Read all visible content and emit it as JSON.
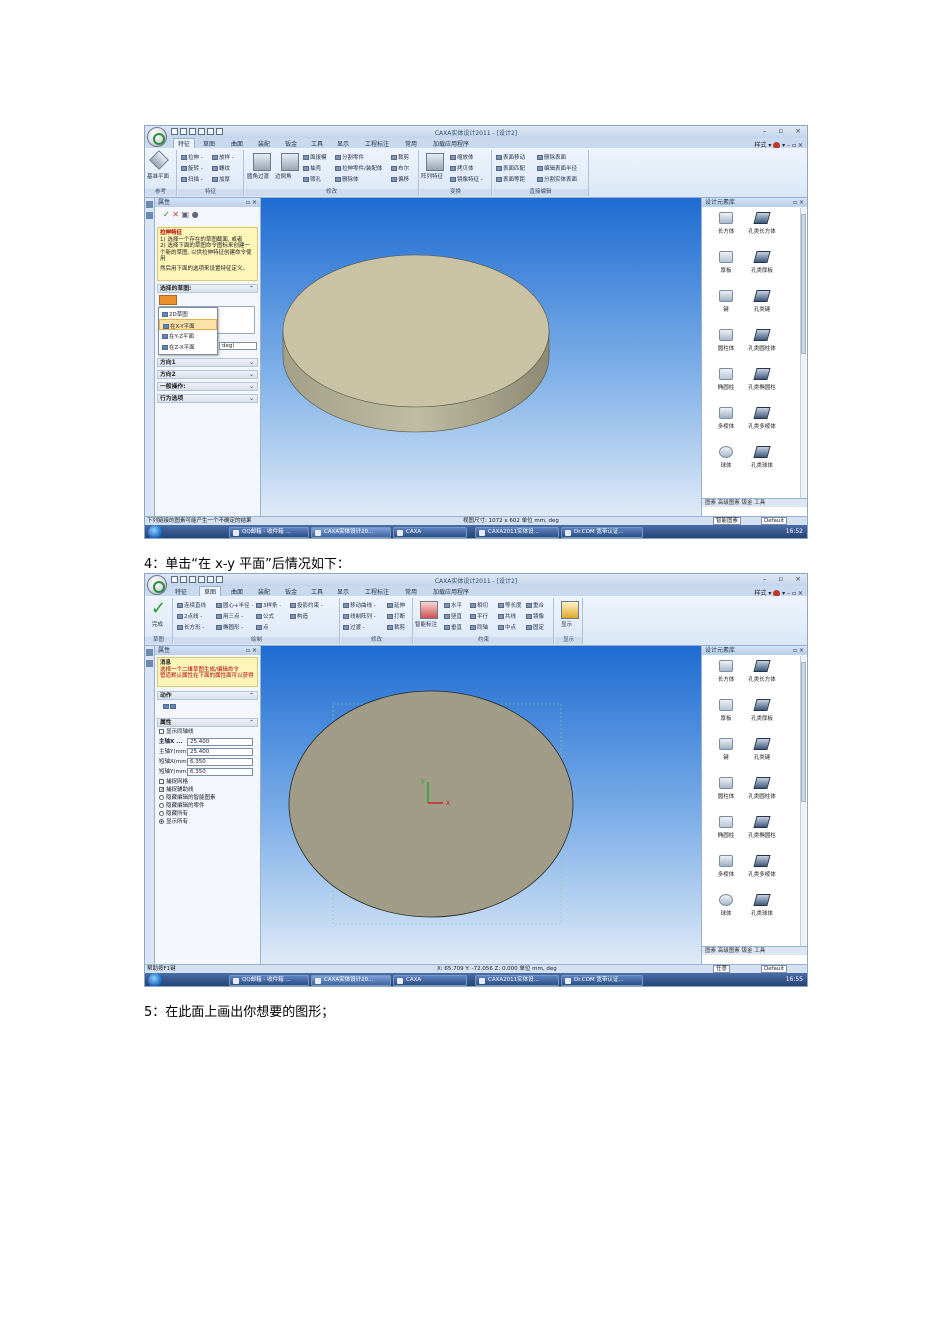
{
  "captions": {
    "step4": "4：单击“在 x-y 平面”后情况如下：",
    "step5": "5：在此面上画出你想要的图形；"
  },
  "app": {
    "window_title": "CAXA实体设计2011 - [设计2]",
    "style_label": "样式",
    "window_controls": [
      "–",
      "▫",
      "×"
    ]
  },
  "shot1": {
    "tabs": [
      "特征",
      "草图",
      "曲面",
      "装配",
      "钣金",
      "工具",
      "显示",
      "工程标注",
      "常用",
      "加载应用程序"
    ],
    "active_tab": "特征",
    "ribbon_groups": [
      {
        "label": "参考",
        "items": [
          "基准平面"
        ]
      },
      {
        "label": "特征",
        "items": [
          "拉伸 -",
          "旋转 -",
          "扫描 -",
          "放样 -",
          "螺纹",
          "加厚"
        ]
      },
      {
        "label": "修改",
        "items": [
          "圆角过渡",
          "边倒角",
          "面拔模",
          "抽壳",
          "筛孔",
          "分割零件",
          "拉伸零件/装配体",
          "删除体",
          "裁剪",
          "布尔",
          "偏移"
        ]
      },
      {
        "label": "变换",
        "items": [
          "阵列特征",
          "镜像特征 -",
          "缩放体",
          "拷贝体"
        ]
      },
      {
        "label": "直接编辑",
        "items": [
          "表面移动",
          "表面匹配",
          "表面等距",
          "删除表面",
          "编辑表面半径",
          "分割实体表面"
        ]
      }
    ],
    "property_panel_title": "属性",
    "help_title": "拉伸特征",
    "help_lines": [
      "1) 选择一个存在的草图截面, 或者",
      "2) 选择下面的草图命令图标来创建一个新的草图, 以供拉伸特征创建命令使用",
      "然后用下面的选项来设置特征定义。"
    ],
    "sketch_section": "选择的草图:",
    "dropdown_items": [
      "2D草图",
      "在X-Y平面",
      "在Y-Z平面",
      "在Z-X平面"
    ],
    "highlighted_item": "在X-Y平面",
    "partial_value": "deg)",
    "sections": [
      "方向1",
      "方向2",
      "一般操作:",
      "行为选项"
    ],
    "library_title": "设计元素库",
    "library_items": [
      [
        "长方体",
        "孔类长方体"
      ],
      [
        "厚板",
        "孔类厚板"
      ],
      [
        "键",
        "孔类键"
      ],
      [
        "圆柱体",
        "孔类圆柱体"
      ],
      [
        "椭圆柱",
        "孔类椭圆柱"
      ],
      [
        "多棱体",
        "孔类多棱体"
      ],
      [
        "球体",
        "孔类球体"
      ]
    ],
    "library_tabs": "图素  高级图素  钣金  工具",
    "status_left": "下列链接的图素可能产生一个不确定的结果",
    "status_right": "视图尺寸: 1072 x 602  单位 mm, deg",
    "status_combo": "智能图素",
    "status_default": "Default",
    "clock": "16:52"
  },
  "shot2": {
    "tabs": [
      "特征",
      "草图",
      "曲面",
      "装配",
      "钣金",
      "工具",
      "显示",
      "工程标注",
      "常用",
      "加载应用程序"
    ],
    "active_tab": "草图",
    "ribbon_groups": [
      {
        "label": "草图",
        "items": [
          "完成"
        ]
      },
      {
        "label": "绘制",
        "items": [
          "连续直线",
          "圆心+半径 -",
          "3样条 -",
          "投影约束 -",
          "2点线 -",
          "用三点 -",
          "公式",
          "构造",
          "长方形 -",
          "椭圆形 -",
          "点"
        ]
      },
      {
        "label": "修改",
        "items": [
          "移动曲线 -",
          "延伸",
          "线制阵列 -",
          "打断",
          "过渡 -",
          "裁剪"
        ]
      },
      {
        "label": "约束",
        "items": [
          "智能标注",
          "水平",
          "相切",
          "等长度",
          "重合",
          "垂直",
          "平行",
          "共线",
          "镜像",
          "竖直",
          "同轴",
          "中点",
          "固定"
        ]
      },
      {
        "label": "显示",
        "items": [
          "显示"
        ]
      }
    ],
    "property_panel_title": "属性",
    "message_title": "消息",
    "message_lines": [
      "选择一个二维草图生成/编辑命令",
      "管道默认属性在下面的属性面可以获得"
    ],
    "action_section": "动作",
    "props_section": "属性",
    "show_curve_label": "显示同轴线",
    "fields": [
      {
        "label": "主轴X ...",
        "value": "25.400"
      },
      {
        "label": "主轴Y(mm)",
        "value": "25.400"
      },
      {
        "label": "短轴X(mm)",
        "value": "6.350"
      },
      {
        "label": "短轴Y(mm)",
        "value": "6.350"
      }
    ],
    "checks": [
      "捕捉网格",
      "捕捉辅助线"
    ],
    "radios": [
      "隐藏编辑的智能图素",
      "隐藏编辑的零件",
      "隐藏所有",
      "显示所有"
    ],
    "selected_radio": "显示所有",
    "library_title": "设计元素库",
    "library_items": [
      [
        "长方体",
        "孔类长方体"
      ],
      [
        "厚板",
        "孔类厚板"
      ],
      [
        "键",
        "孔类键"
      ],
      [
        "圆柱体",
        "孔类圆柱体"
      ],
      [
        "椭圆柱",
        "孔类椭圆柱"
      ],
      [
        "多棱体",
        "孔类多棱体"
      ],
      [
        "球体",
        "孔类球体"
      ]
    ],
    "library_tabs": "图素  高级图素  钣金  工具",
    "status_left": "帮助按F1键",
    "status_right": "X: 65.709 Y: -72.056 Z: 0.000  单位 mm, deg",
    "status_combo": "任意",
    "status_default": "Default",
    "axis_x_label": "X",
    "axis_y_label": "Y",
    "clock": "16:55"
  },
  "taskbar": {
    "items": [
      "QQ邮箱 - 收件箱 ...",
      "CAXA实体设计20...",
      "CAXA",
      "CAXA2011实体设...",
      "Dr.COM 宽带认证..."
    ],
    "active_index": 1
  }
}
